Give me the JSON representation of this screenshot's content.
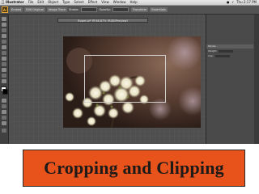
{
  "menubar": {
    "apple_icon": "apple-icon",
    "app_name": "Illustrator",
    "items": [
      "File",
      "Edit",
      "Object",
      "Type",
      "Select",
      "Effect",
      "View",
      "Window",
      "Help"
    ],
    "clock": "Thu 2:17 PM"
  },
  "controlbar": {
    "logo": "Ai",
    "workspace_label": "Essentials",
    "stroke_label": "Stroke:",
    "opacity_label": "Opacity:",
    "embed_label": "Embed",
    "edit_original_label": "Edit Original",
    "trace_label": "Image Trace",
    "transform_label": "Transform"
  },
  "document": {
    "tab_title": "flower.ai* @ 66.67% (RGB/Preview)"
  },
  "panel": {
    "header": "Stroke",
    "row1_label": "Weight:",
    "row2_label": "Cap:"
  },
  "banner": {
    "title": "Cropping and Clipping",
    "bg_color": "#e8531c"
  }
}
